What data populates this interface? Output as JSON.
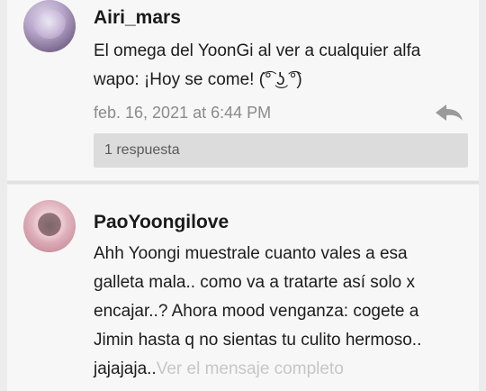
{
  "comments": [
    {
      "username": "Airi_mars",
      "avatar_icon": "user-avatar",
      "message": "El omega del YoonGi al ver a cualquier alfa\nwapo: ¡Hoy se come! (͡° ͜ʖ ͡°)",
      "timestamp": "feb. 16, 2021 at 6:44 PM",
      "reply_icon": "reply-arrow-icon",
      "replies_label": "1 respuesta"
    },
    {
      "username": "PaoYoongilove",
      "avatar_icon": "user-avatar",
      "message": "Ahh Yoongi muestrale cuanto vales a esa\ngalleta mala.. como va a tratarte así solo x\nencajar..? Ahora mood venganza: cogete a\nJimin hasta q no sientas tu culito hermoso..\njajajaja..",
      "read_more": "Ver el mensaje completo"
    }
  ],
  "colors": {
    "card_bg": "#f7f7f7",
    "page_bg": "#ececec",
    "muted_text": "#8a8a8a",
    "replies_bar": "#dcdcdc"
  }
}
